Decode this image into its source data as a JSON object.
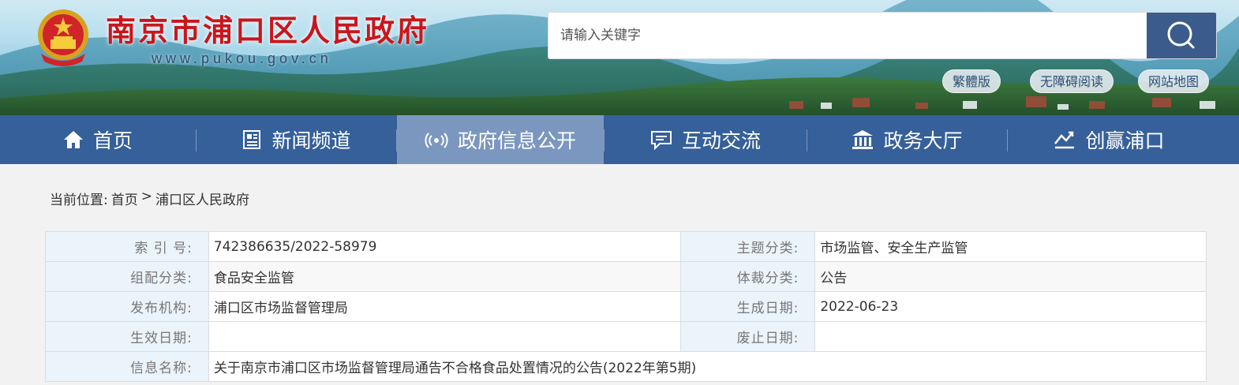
{
  "header": {
    "site_title": "南京市浦口区人民政府",
    "site_url": "www.pukou.gov.cn",
    "search_placeholder": "请输入关键字",
    "links": [
      "繁體版",
      "无障碍阅读",
      "网站地图"
    ]
  },
  "nav": {
    "items": [
      {
        "label": "首页",
        "icon": "home-icon"
      },
      {
        "label": "新闻频道",
        "icon": "newspaper-icon"
      },
      {
        "label": "政府信息公开",
        "icon": "broadcast-icon"
      },
      {
        "label": "互动交流",
        "icon": "chat-icon"
      },
      {
        "label": "政务大厅",
        "icon": "building-icon"
      },
      {
        "label": "创赢浦口",
        "icon": "growth-icon"
      }
    ],
    "active_index": 2
  },
  "breadcrumb": {
    "prefix": "当前位置:",
    "items": [
      "首页",
      "浦口区人民政府"
    ],
    "separator": ">"
  },
  "meta": {
    "rows": [
      {
        "label1": "索 引 号:",
        "value1": "742386635/2022-58979",
        "label2": "主题分类:",
        "value2": "市场监管、安全生产监管"
      },
      {
        "label1": "组配分类:",
        "value1": "食品安全监管",
        "label2": "体裁分类:",
        "value2": "公告"
      },
      {
        "label1": "发布机构:",
        "value1": "浦口区市场监督管理局",
        "label2": "生成日期:",
        "value2": "2022-06-23"
      },
      {
        "label1": "生效日期:",
        "value1": "",
        "label2": "废止日期:",
        "value2": ""
      }
    ],
    "title_label": "信息名称:",
    "title_value": "关于南京市浦口区市场监督管理局通告不合格食品处置情况的公告(2022年第5期)"
  },
  "colors": {
    "nav_bg": "#36609a",
    "nav_active": "#7c97bf",
    "title_red": "#c8161d",
    "label_bg": "#ebf3fb"
  }
}
